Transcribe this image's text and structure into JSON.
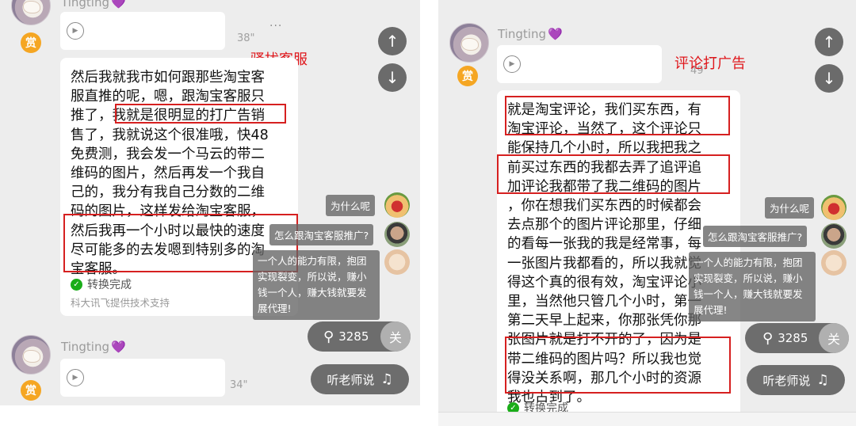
{
  "left": {
    "top_nick": "Tingting",
    "heart": "💜",
    "voice1_duration": "38\"",
    "dots": "···",
    "reward": "赏",
    "annotation": "骚扰客服",
    "message_lines": [
      "然后我就我市如何跟那些淘宝客",
      "服直推的呢，嗯，跟淘宝客服只",
      "推了，我就是很明显的打广告销",
      "售了，我就说这个很准哦，快48",
      "免费测，我会发一个马云的带二",
      "维码的图片，然后再发一个我自",
      "己的，我分有我自己分数的二维",
      "码的图片，这样发给淘宝客服，",
      "然后我再一个小时以最快的速度",
      "尽可能多的去发嗯到特别多的淘",
      "宝客服。"
    ],
    "status": "转换完成",
    "credit": "科大讯飞提供技术支持",
    "second_nick": "Tingting",
    "voice2_duration": "34\"",
    "chip_why": "为什么呢",
    "chip_how": "怎么跟淘宝客服推广?",
    "chip_long": [
      "一个人的能力有限，抱团",
      "实现裂变，所以说，赚小",
      "钱一个人，赚大钱就要发",
      "展代理!"
    ],
    "listener_count": "3285",
    "close_label": "关",
    "listen_label": "听老师说"
  },
  "right": {
    "nick": "Tingting",
    "heart": "💜",
    "voice_duration": "49\"",
    "dots": "···",
    "reward": "赏",
    "annotation": "评论打广告",
    "message_lines": [
      "就是淘宝评论，我们买东西，有",
      "淘宝评论，当然了，这个评论只",
      "能保持几个小时，所以我把我之",
      "前买过东西的我都去弄了追评追",
      "加评论我都带了我二维码的图片",
      "，你在想我们买东西的时候都会",
      "去点那个的图片评论那里，仔细",
      "的看每一张我的我是经常事，每",
      "一张图片我都看的，所以我就觉",
      "得这个真的很有效，淘宝评论小",
      "里，当然他只管几个小时，第一",
      "第二天早上起来，你那张凭你那",
      "张图片就是打不开的了，因为是",
      "带二维码的图片吗？所以我也觉",
      "得没关系啊，那几个小时的资源",
      "我也占到了。"
    ],
    "status": "转换完成",
    "chip_why": "为什么呢",
    "chip_how": "怎么跟淘宝客服推广?",
    "chip_long": [
      "一个人的能力有限，抱团",
      "实现裂变，所以说，赚小",
      "钱一个人，赚大钱就要发",
      "展代理!"
    ],
    "listener_count": "3285",
    "close_label": "关",
    "listen_label": "听老师说"
  },
  "icons": {
    "up": "↑",
    "down": "↓",
    "play": "▶",
    "listeners": "⚲",
    "headphones": "♫"
  },
  "colors": {
    "annotation": "#e0161b",
    "reward": "#f5a623",
    "check": "#1aad19",
    "nickname_heart": "#9b4dd4"
  }
}
